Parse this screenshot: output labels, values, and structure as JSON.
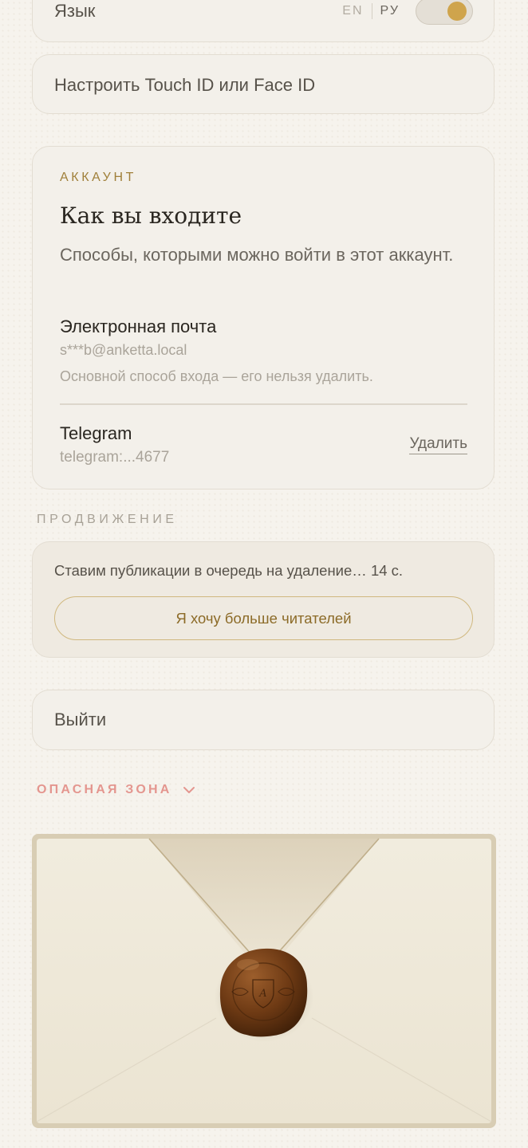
{
  "language": {
    "label": "Язык",
    "options": [
      "EN",
      "РУ"
    ],
    "selected": "РУ"
  },
  "biometrics": {
    "label": "Настроить Touch ID или Face ID"
  },
  "account": {
    "eyebrow": "АККАУНТ",
    "title": "Как вы входите",
    "description": "Способы, которыми можно войти в этот аккаунт.",
    "methods": [
      {
        "title": "Электронная почта",
        "value": "s***b@anketta.local",
        "note": "Основной способ входа — его нельзя удалить."
      },
      {
        "title": "Telegram",
        "value": "telegram:...4677",
        "action": "Удалить"
      }
    ]
  },
  "promotion": {
    "heading": "ПРОДВИЖЕНИЕ",
    "status": "Ставим публикации в очередь на удаление… 14 с.",
    "button": "Я хочу больше читателей"
  },
  "logout": {
    "label": "Выйти"
  },
  "danger_zone": {
    "label": "ОПАСНАЯ ЗОНА",
    "expanded": false
  },
  "envelope": {
    "seal_monogram": "A",
    "colors": {
      "paper": "#efe9da",
      "frame": "#d8cdb4",
      "seal": "#6a3712",
      "accent": "#cfa44c",
      "danger": "#e4968f"
    }
  }
}
